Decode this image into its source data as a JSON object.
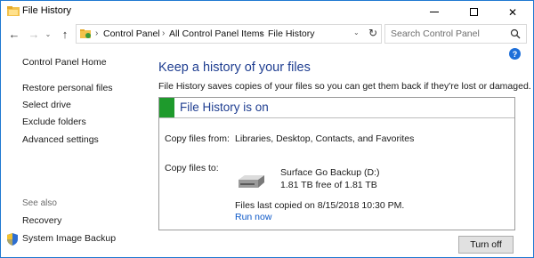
{
  "window": {
    "title": "File History",
    "minimize_label": "",
    "maximize_label": "",
    "close_label": "✕"
  },
  "address": {
    "crumbs": [
      "Control Panel",
      "All Control Panel Items",
      "File History"
    ],
    "separator": "›"
  },
  "search": {
    "placeholder": "Search Control Panel"
  },
  "nav": {
    "back": "←",
    "forward": "→",
    "recent": "⌄",
    "up": "↑",
    "refresh": "↻"
  },
  "help": {
    "label": "?"
  },
  "sidebar": {
    "home": "Control Panel Home",
    "items": [
      "Restore personal files",
      "Select drive",
      "Exclude folders",
      "Advanced settings"
    ],
    "see_also_label": "See also",
    "see_also": [
      "Recovery",
      "System Image Backup"
    ]
  },
  "main": {
    "heading": "Keep a history of your files",
    "description": "File History saves copies of your files so you can get them back if they're lost or damaged.",
    "status": "File History is on",
    "copy_from_label": "Copy files from:",
    "copy_from_value": "Libraries, Desktop, Contacts, and Favorites",
    "copy_to_label": "Copy files to:",
    "drive_name": "Surface Go Backup (D:)",
    "drive_space": "1.81 TB free of 1.81 TB",
    "last_copied": "Files last copied on 8/15/2018 10:30 PM.",
    "run_now": "Run now",
    "turn_off": "Turn off"
  },
  "colors": {
    "accent_heading": "#1f3e91",
    "status_green": "#1e9a2c",
    "link": "#0b57c7",
    "window_border": "#1f79d1"
  },
  "icons": {
    "title": "file-history-icon",
    "address": "control-panel-icon",
    "drive": "hard-drive-icon",
    "shield": "uac-shield-icon",
    "search": "search-icon"
  }
}
